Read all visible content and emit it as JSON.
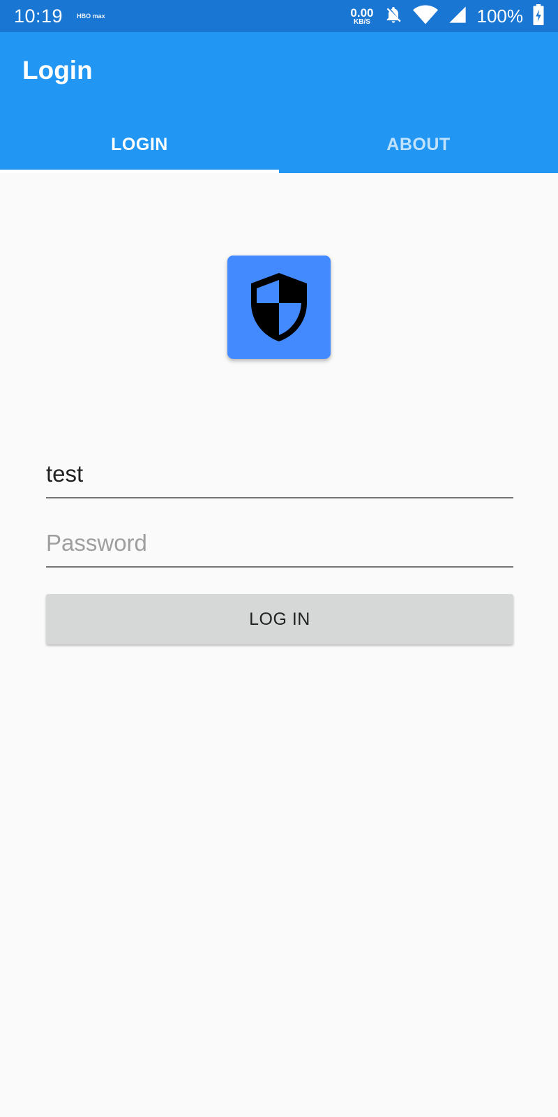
{
  "status_bar": {
    "time": "10:19",
    "app_icon": "hbo-max-icon",
    "app_icon_text": "HBO max",
    "net_speed_value": "0.00",
    "net_speed_unit": "KB/S",
    "battery": "100%",
    "icons": [
      "bell-off-icon",
      "wifi-icon",
      "signal-icon",
      "battery-charging-icon"
    ]
  },
  "app_bar": {
    "title": "Login"
  },
  "tabs": [
    {
      "label": "LOGIN",
      "active": true
    },
    {
      "label": "ABOUT",
      "active": false
    }
  ],
  "logo": {
    "icon": "shield-icon",
    "background": "#448aff"
  },
  "form": {
    "username_value": "test",
    "username_placeholder": "",
    "password_value": "",
    "password_placeholder": "Password",
    "submit_label": "LOG IN"
  },
  "colors": {
    "primary": "#2196f3",
    "status_bar": "#1976d2",
    "button_bg": "#d6d7d7",
    "page_bg": "#fafafa"
  }
}
